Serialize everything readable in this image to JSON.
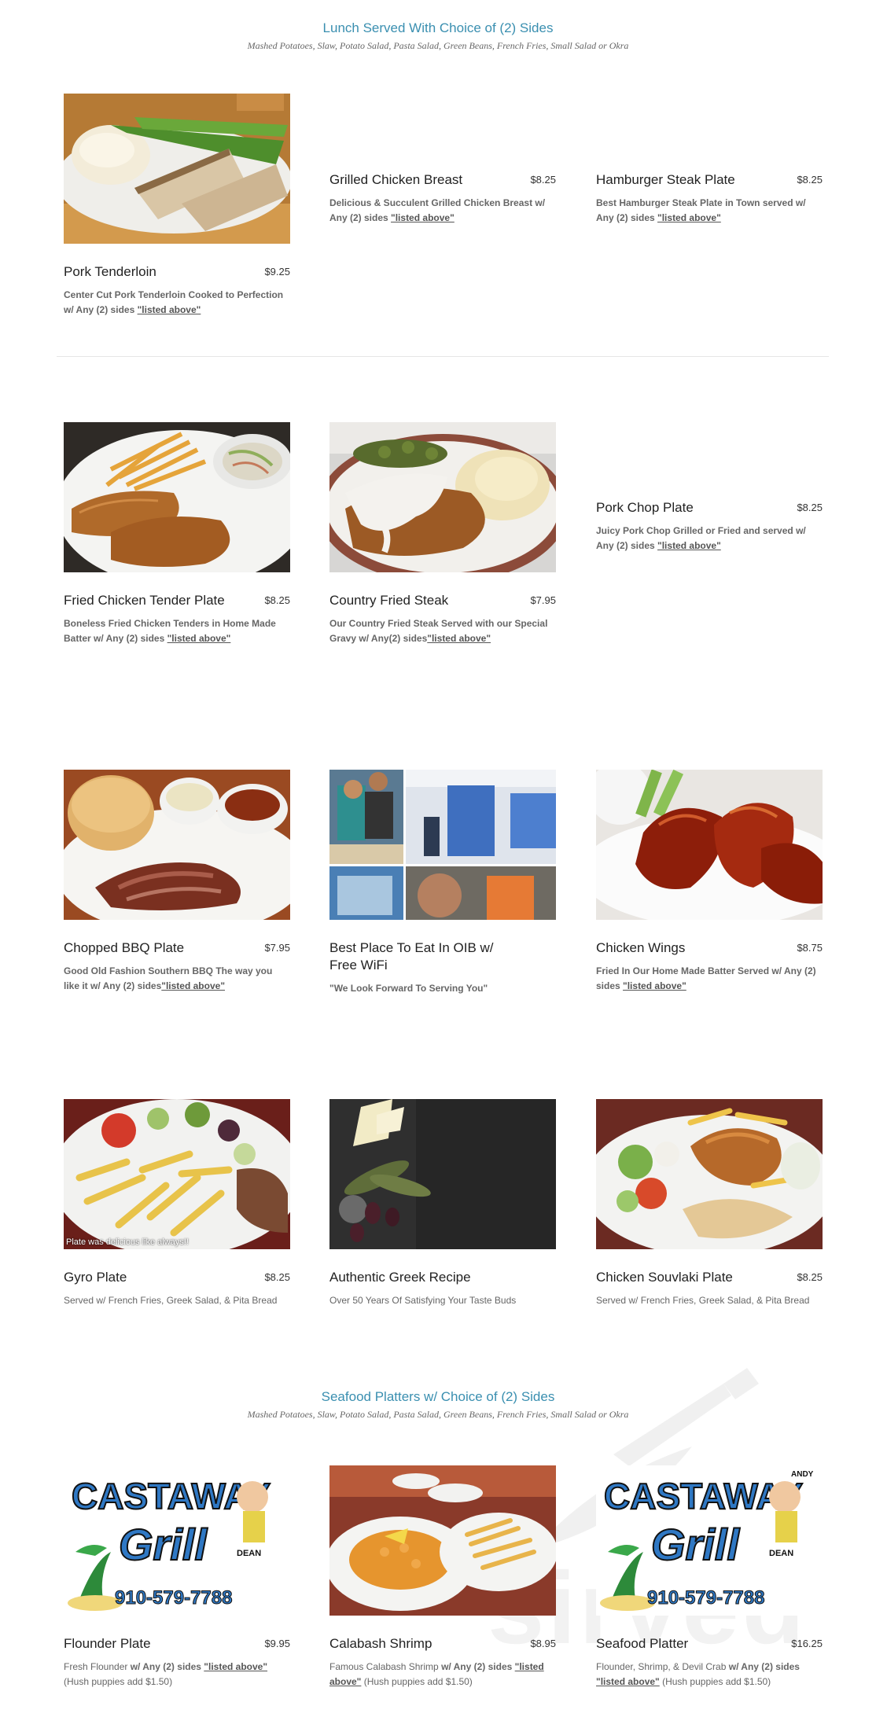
{
  "lunch_section": {
    "title": "Lunch Served With Choice of (2) Sides",
    "subtitle": "Mashed Potatoes, Slaw, Potato Salad, Pasta Salad, Green Beans, French Fries, Small Salad or Okra"
  },
  "seafood_section": {
    "title": "Seafood Platters w/ Choice of (2) Sides",
    "subtitle": "Mashed Potatoes, Slaw, Potato Salad, Pasta Salad, Green Beans, French Fries, Small Salad or Okra"
  },
  "link_text": "\"listed above\"",
  "items": {
    "pork_tenderloin": {
      "name": "Pork Tenderloin",
      "price": "$9.25",
      "desc": "Center Cut Pork Tenderloin Cooked to Perfection w/ Any (2) sides "
    },
    "grilled_chicken": {
      "name": "Grilled Chicken Breast",
      "price": "$8.25",
      "desc": "Delicious & Succulent Grilled Chicken Breast w/ Any (2) sides "
    },
    "hamburger_steak": {
      "name": "Hamburger Steak Plate",
      "price": "$8.25",
      "desc": "Best Hamburger Steak Plate in Town served w/ Any (2) sides "
    },
    "fried_chicken_tender": {
      "name": "Fried Chicken Tender Plate",
      "price": "$8.25",
      "desc": "Boneless Fried Chicken Tenders in Home Made Batter w/ Any (2) sides "
    },
    "country_fried_steak": {
      "name": "Country Fried Steak",
      "price": "$7.95",
      "desc": "Our Country Fried Steak Served with our Special Gravy w/ Any(2) sides"
    },
    "pork_chop": {
      "name": "Pork Chop Plate",
      "price": "$8.25",
      "desc": "Juicy Pork Chop Grilled or Fried and served w/ Any (2) sides "
    },
    "chopped_bbq": {
      "name": "Chopped BBQ Plate",
      "price": "$7.95",
      "desc": "Good Old Fashion Southern BBQ The way you like it w/ Any (2) sides"
    },
    "best_place": {
      "name": "Best Place To Eat In OIB w/ Free WiFi",
      "price": "",
      "desc": "\"We Look Forward To Serving You\""
    },
    "chicken_wings": {
      "name": "Chicken Wings",
      "price": "$8.75",
      "desc": "Fried In Our Home Made Batter Served w/ Any (2) sides "
    },
    "gyro": {
      "name": "Gyro Plate",
      "price": "$8.25",
      "desc": "Served w/ French Fries, Greek Salad, & Pita Bread",
      "caption": "Plate was delicious like always!!"
    },
    "greek_recipe": {
      "name": "Authentic Greek Recipe",
      "price": "",
      "desc": "Over 50 Years Of Satisfying Your Taste Buds"
    },
    "souvlaki": {
      "name": "Chicken Souvlaki Plate",
      "price": "$8.25",
      "desc": "Served w/ French Fries, Greek Salad, & Pita Bread"
    },
    "flounder": {
      "name": "Flounder Plate",
      "price": "$9.95",
      "desc_pre": "Fresh Flounder ",
      "desc_bold": "w/ Any (2) sides ",
      "desc_post": " (Hush puppies add $1.50)"
    },
    "calabash_shrimp": {
      "name": "Calabash Shrimp",
      "price": "$8.95",
      "desc_pre": "Famous Calabash Shrimp ",
      "desc_bold": "w/ Any (2) sides ",
      "desc_post": " (Hush puppies add $1.50)"
    },
    "seafood_platter": {
      "name": "Seafood Platter",
      "price": "$16.25",
      "desc_pre": "Flounder, Shrimp, & Devil Crab ",
      "desc_bold": "w/ Any (2) sides ",
      "desc_post": " (Hush puppies add $1.50)"
    }
  },
  "logo": {
    "line1": "CASTAWAY",
    "line2": "Grill",
    "phone": "910-579-7788",
    "name_tag": "DEAN",
    "name_tag2": "ANDY"
  },
  "watermark": {
    "text": "sirved"
  },
  "colors": {
    "accent": "#3a8fb0",
    "logo_blue": "#2f78c4"
  }
}
